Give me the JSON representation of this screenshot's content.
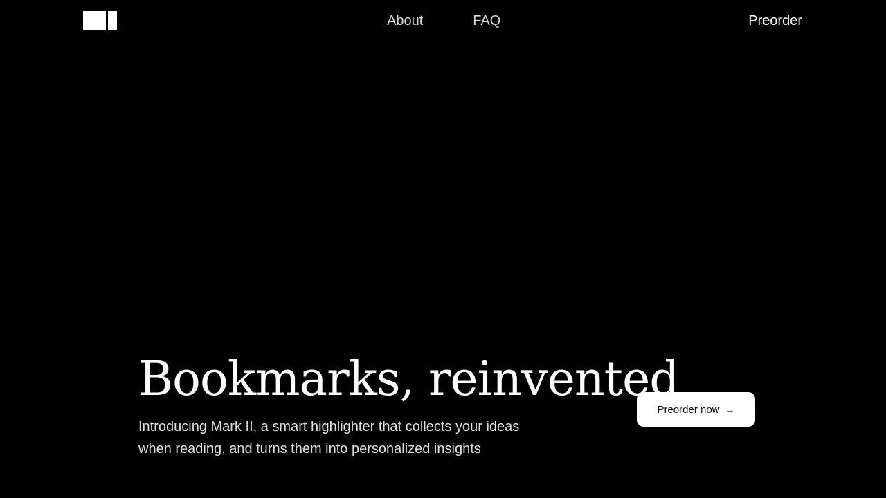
{
  "header": {
    "logo_icon": "logo-mark-icon",
    "nav": [
      {
        "label": "About"
      },
      {
        "label": "FAQ"
      }
    ],
    "preorder_label": "Preorder"
  },
  "hero": {
    "title": "Bookmarks, reinvented",
    "subtitle": "Introducing Mark II, a smart highlighter that collects your ideas when reading, and turns them into personalized insights",
    "cta_label": "Preorder now",
    "cta_icon": "arrow-right-icon",
    "cta_arrow": "→"
  },
  "colors": {
    "background": "#000000",
    "text": "#ffffff",
    "nav_text": "#d9d9d9",
    "cta_background": "#ffffff",
    "cta_text": "#111111"
  }
}
